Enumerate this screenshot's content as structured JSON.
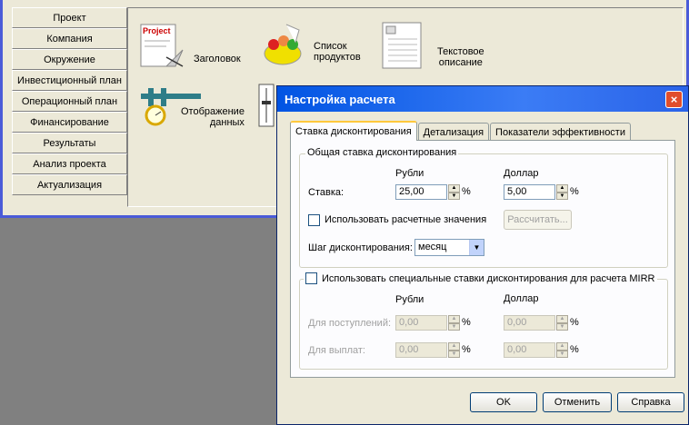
{
  "sidebar": {
    "items": [
      {
        "label": "Проект"
      },
      {
        "label": "Компания"
      },
      {
        "label": "Окружение"
      },
      {
        "label": "Инвестиционный план"
      },
      {
        "label": "Операционный план"
      },
      {
        "label": "Финансирование"
      },
      {
        "label": "Результаты"
      },
      {
        "label": "Анализ проекта"
      },
      {
        "label": "Актуализация"
      }
    ]
  },
  "modules": {
    "title_label": "Заголовок",
    "products_label_1": "Список",
    "products_label_2": "продуктов",
    "text_label_1": "Текстовое",
    "text_label_2": "описание",
    "display_label_1": "Отображение",
    "display_label_2": "данных",
    "project_icon_text": "Project"
  },
  "dialog": {
    "title": "Настройка расчета",
    "close": "×",
    "tabs": [
      {
        "label": "Ставка дисконтирования",
        "active": true
      },
      {
        "label": "Детализация",
        "active": false
      },
      {
        "label": "Показатели эффективности",
        "active": false
      }
    ],
    "general_group": {
      "title": "Общая ставка дисконтирования",
      "col_rub": "Рубли",
      "col_usd": "Доллар",
      "rate_label": "Ставка:",
      "rate_rub": "25,00",
      "rate_usd": "5,00",
      "pct": "%",
      "use_calc_label": "Использовать расчетные значения",
      "calc_button": "Рассчитать...",
      "step_label": "Шаг дисконтирования:",
      "step_value": "месяц"
    },
    "mirr_group": {
      "checkbox_label": "Использовать специальные ставки дисконтирования для расчета MIRR",
      "col_rub": "Рубли",
      "col_usd": "Доллар",
      "income_label": "Для поступлений:",
      "payment_label": "Для выплат:",
      "income_rub": "0,00",
      "income_usd": "0,00",
      "payment_rub": "0,00",
      "payment_usd": "0,00",
      "pct": "%"
    },
    "buttons": {
      "ok": "OK",
      "cancel": "Отменить",
      "help": "Справка"
    }
  }
}
